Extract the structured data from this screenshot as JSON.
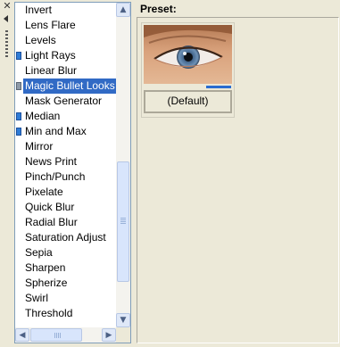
{
  "effects_list": {
    "items": [
      {
        "label": "Invert",
        "marker": ""
      },
      {
        "label": "Lens Flare",
        "marker": ""
      },
      {
        "label": "Levels",
        "marker": ""
      },
      {
        "label": "Light Rays",
        "marker": "blue"
      },
      {
        "label": "Linear Blur",
        "marker": ""
      },
      {
        "label": "Magic Bullet Looks",
        "marker": "gray",
        "selected": true
      },
      {
        "label": "Mask Generator",
        "marker": ""
      },
      {
        "label": "Median",
        "marker": "blue"
      },
      {
        "label": "Min and Max",
        "marker": "blue"
      },
      {
        "label": "Mirror",
        "marker": ""
      },
      {
        "label": "News Print",
        "marker": ""
      },
      {
        "label": "Pinch/Punch",
        "marker": ""
      },
      {
        "label": "Pixelate",
        "marker": ""
      },
      {
        "label": "Quick Blur",
        "marker": ""
      },
      {
        "label": "Radial Blur",
        "marker": ""
      },
      {
        "label": "Saturation Adjust",
        "marker": ""
      },
      {
        "label": "Sepia",
        "marker": ""
      },
      {
        "label": "Sharpen",
        "marker": ""
      },
      {
        "label": "Spherize",
        "marker": ""
      },
      {
        "label": "Swirl",
        "marker": ""
      },
      {
        "label": "Threshold",
        "marker": ""
      }
    ]
  },
  "icons": {
    "close": "close-icon",
    "collapse": "collapse-arrow-icon",
    "grip": "grip-icon",
    "scroll_up": "scroll-up-arrow-icon",
    "scroll_down": "scroll-down-arrow-icon",
    "scroll_left": "scroll-left-arrow-icon",
    "scroll_right": "scroll-right-arrow-icon"
  },
  "preset": {
    "title": "Preset:",
    "items": [
      {
        "label": "(Default)",
        "thumbnail": "eye-thumbnail",
        "selected": true
      }
    ]
  },
  "colors": {
    "selection": "#316ac5",
    "marker_blue": "#2e7bd6",
    "marker_gray": "#8e9aa8",
    "preset_selection_bar": "#2a6cd0"
  }
}
